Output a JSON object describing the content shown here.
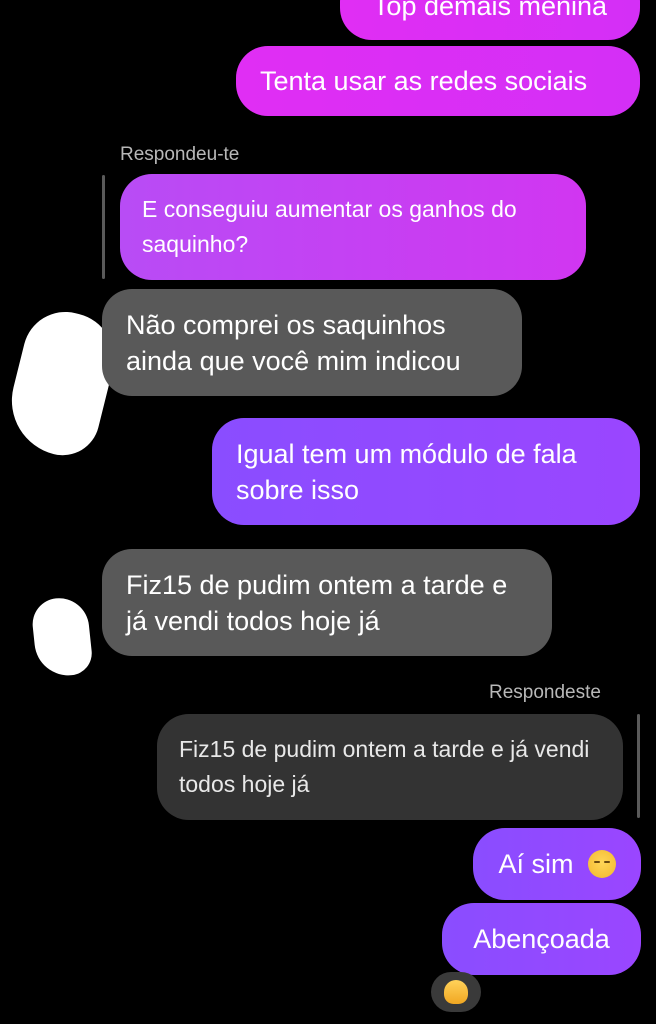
{
  "messages": {
    "m1": "Top demais menina",
    "m2": "Tenta usar as redes sociais",
    "reply_label_1": "Respondeu-te",
    "quoted_1": "E conseguiu aumentar os ganhos do saquinho?",
    "m3": "Não comprei os saquinhos ainda que você mim indicou",
    "m4": "Igual tem um módulo de fala sobre isso",
    "m5": "Fiz15 de pudim ontem a tarde e já vendi todos hoje já",
    "reply_label_2": "Respondeste",
    "quoted_2": "Fiz15 de pudim ontem a tarde e já vendi todos hoje já",
    "m6": "Aí sim",
    "m7": "Abençoada"
  },
  "icons": {
    "m6_emoji": "relieved-face-emoji",
    "reaction": "clapping-hands-emoji"
  },
  "colors": {
    "background": "#000000",
    "sent_pink": "#d92ff5",
    "sent_violet": "#9047ff",
    "received": "#595959",
    "quoted_out": "#333333"
  }
}
